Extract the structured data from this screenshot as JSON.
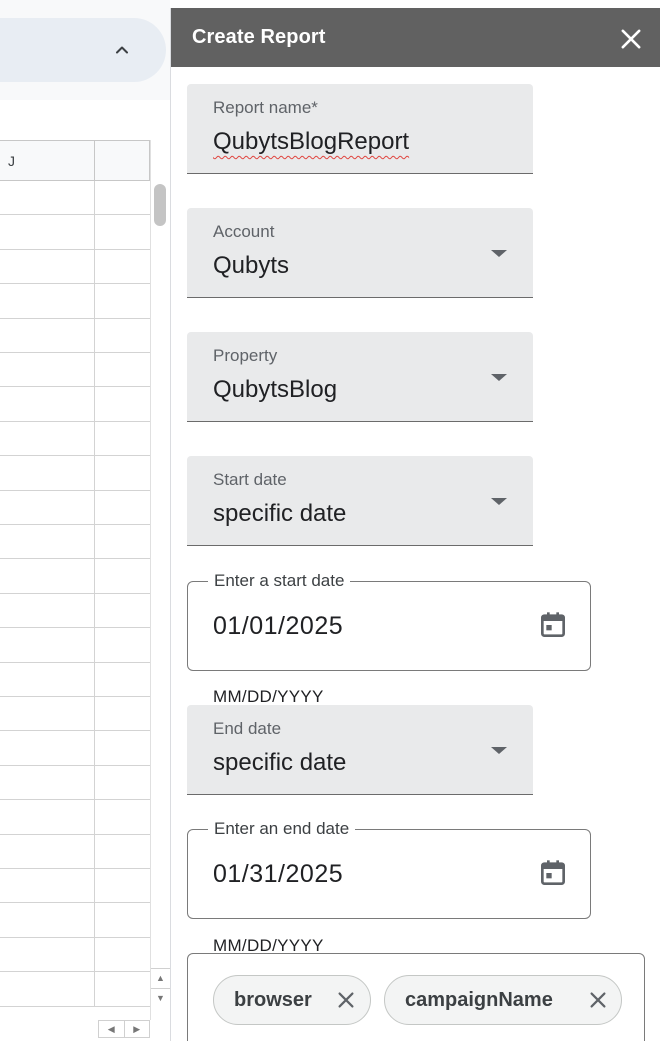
{
  "sheet": {
    "column_j_label": "J",
    "collapse_icon": "chevron-up-icon",
    "row_count": 24
  },
  "panel": {
    "title": "Create Report",
    "close_icon": "close-icon",
    "header_color": "#616161"
  },
  "form": {
    "report_name": {
      "label": "Report name*",
      "value": "QubytsBlogReport"
    },
    "account": {
      "label": "Account",
      "value": "Qubyts"
    },
    "property": {
      "label": "Property",
      "value": "QubytsBlog"
    },
    "start_date_mode": {
      "label": "Start date",
      "value": "specific date"
    },
    "start_date": {
      "label": "Enter a start date",
      "value": "01/01/2025",
      "hint": "MM/DD/YYYY",
      "icon": "calendar-icon"
    },
    "end_date_mode": {
      "label": "End date",
      "value": "specific date"
    },
    "end_date": {
      "label": "Enter an end date",
      "value": "01/31/2025",
      "hint": "MM/DD/YYYY",
      "icon": "calendar-icon"
    },
    "dimensions": [
      {
        "label": "browser"
      },
      {
        "label": "campaignName"
      }
    ]
  },
  "colors": {
    "field_fill": "#e9eaeb",
    "spellcheck_underline": "#e0443e"
  }
}
